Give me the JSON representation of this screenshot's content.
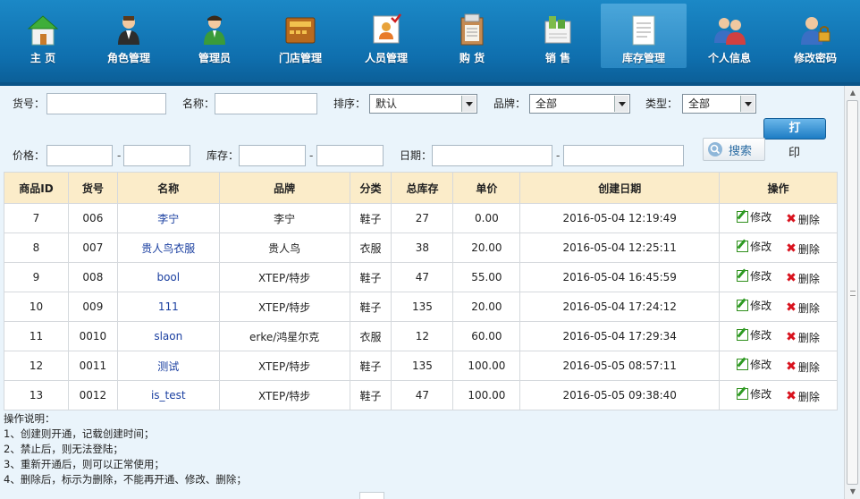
{
  "nav": {
    "items": [
      {
        "label": "主  页",
        "icon": "home-icon"
      },
      {
        "label": "角色管理",
        "icon": "role-icon"
      },
      {
        "label": "管理员",
        "icon": "admin-icon"
      },
      {
        "label": "门店管理",
        "icon": "store-icon"
      },
      {
        "label": "人员管理",
        "icon": "staff-icon"
      },
      {
        "label": "购  货",
        "icon": "purchase-icon"
      },
      {
        "label": "销  售",
        "icon": "sales-icon"
      },
      {
        "label": "库存管理",
        "icon": "inventory-icon"
      },
      {
        "label": "个人信息",
        "icon": "profile-icon"
      },
      {
        "label": "修改密码",
        "icon": "password-icon"
      }
    ],
    "active_index": 7
  },
  "filters": {
    "sku_label": "货号：",
    "sku_value": "",
    "name_label": "名称：",
    "name_value": "",
    "sort_label": "排序：",
    "sort_value": "默认",
    "brand_label": "品牌：",
    "brand_value": "全部",
    "type_label": "类型：",
    "type_value": "全部",
    "price_label": "价格：",
    "price_from": "",
    "price_to": "",
    "stock_label": "库存：",
    "stock_from": "",
    "stock_to": "",
    "date_label": "日期：",
    "date_from": "",
    "date_to": "",
    "range_sep": "-",
    "search_label": "搜索",
    "print_label": "打",
    "print_label_overflow": "印"
  },
  "table": {
    "headers": [
      "商品ID",
      "货号",
      "名称",
      "品牌",
      "分类",
      "总库存",
      "单价",
      "创建日期",
      "操作"
    ],
    "edit_label": "修改",
    "delete_label": "删除",
    "rows": [
      {
        "id": "7",
        "sku": "006",
        "name": "李宁",
        "brand": "李宁",
        "category": "鞋子",
        "stock": "27",
        "price": "0.00",
        "created": "2016-05-04 12:19:49"
      },
      {
        "id": "8",
        "sku": "007",
        "name": "贵人鸟衣服",
        "brand": "贵人鸟",
        "category": "衣服",
        "stock": "38",
        "price": "20.00",
        "created": "2016-05-04 12:25:11"
      },
      {
        "id": "9",
        "sku": "008",
        "name": "bool",
        "brand": "XTEP/特步",
        "category": "鞋子",
        "stock": "47",
        "price": "55.00",
        "created": "2016-05-04 16:45:59"
      },
      {
        "id": "10",
        "sku": "009",
        "name": "111",
        "brand": "XTEP/特步",
        "category": "鞋子",
        "stock": "135",
        "price": "20.00",
        "created": "2016-05-04 17:24:12"
      },
      {
        "id": "11",
        "sku": "0010",
        "name": "slaon",
        "brand": "erke/鸿星尔克",
        "category": "衣服",
        "stock": "12",
        "price": "60.00",
        "created": "2016-05-04 17:29:34"
      },
      {
        "id": "12",
        "sku": "0011",
        "name": "测试",
        "brand": "XTEP/特步",
        "category": "鞋子",
        "stock": "135",
        "price": "100.00",
        "created": "2016-05-05 08:57:11"
      },
      {
        "id": "13",
        "sku": "0012",
        "name": "is_test",
        "brand": "XTEP/特步",
        "category": "鞋子",
        "stock": "47",
        "price": "100.00",
        "created": "2016-05-05 09:38:40"
      }
    ]
  },
  "notes": {
    "title": "操作说明：",
    "lines": [
      "1、创建则开通，记载创建时间；",
      "2、禁止后，则无法登陆；",
      "3、重新开通后，则可以正常使用；",
      "4、删除后，标示为删除，不能再开通、修改、删除；"
    ]
  },
  "colors": {
    "nav_bg": "#1b88c6",
    "header_row_bg": "#fbecc9",
    "link_color": "#1a3fa0",
    "delete_red": "#d9131e",
    "edit_green": "#2d9a22"
  }
}
